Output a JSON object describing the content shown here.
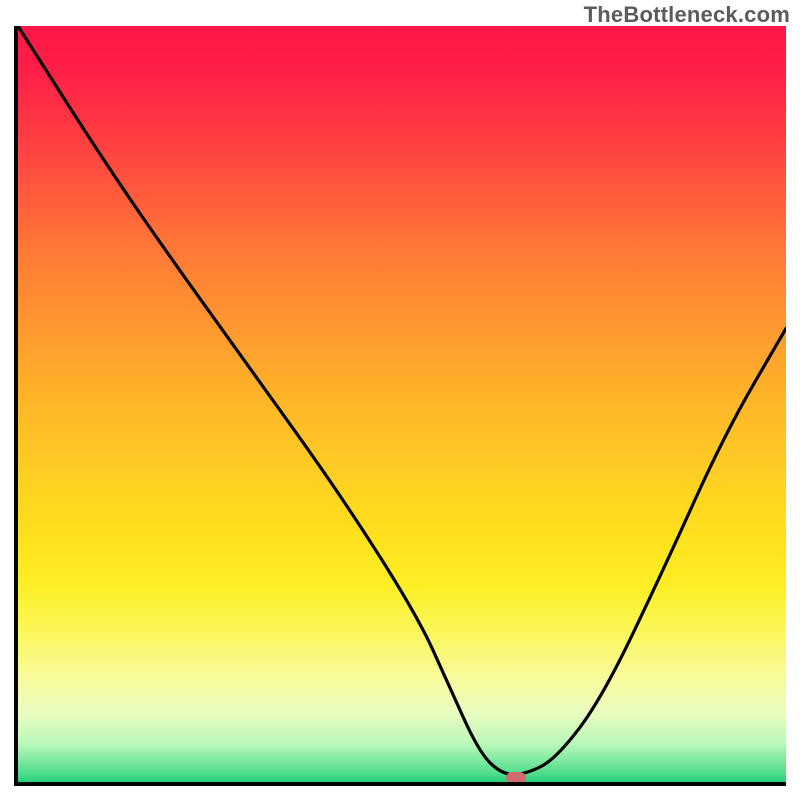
{
  "watermark": "TheBottleneck.com",
  "chart_data": {
    "type": "line",
    "title": "",
    "xlabel": "",
    "ylabel": "",
    "xlim": [
      0,
      100
    ],
    "ylim": [
      0,
      100
    ],
    "grid": false,
    "legend": false,
    "background_gradient": {
      "top_color": "#ff1748",
      "mid_color": "#ffd023",
      "bottom_color": "#23d07a"
    },
    "series": [
      {
        "name": "bottleneck-curve",
        "color": "#000000",
        "x": [
          0,
          10,
          18,
          30,
          42,
          52,
          56,
          60,
          63,
          66,
          70,
          76,
          84,
          92,
          100
        ],
        "y": [
          100,
          84,
          72,
          55,
          38,
          22,
          13,
          4,
          1,
          1,
          3,
          11,
          28,
          46,
          60
        ]
      }
    ],
    "marker": {
      "x": 64.5,
      "y": 1,
      "color": "#cf6a6e"
    }
  }
}
